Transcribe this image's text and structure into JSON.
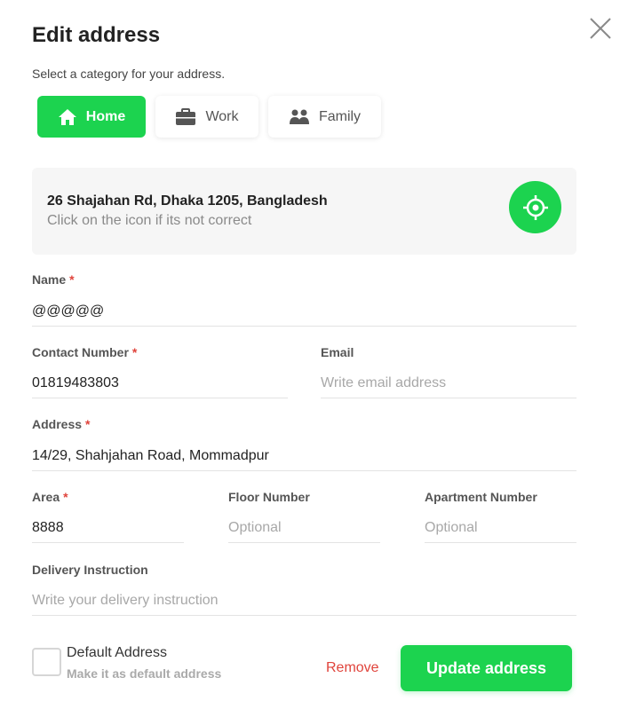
{
  "modal": {
    "title": "Edit address",
    "subtitle": "Select a category for your address."
  },
  "categories": [
    {
      "label": "Home",
      "icon": "home-icon",
      "selected": true
    },
    {
      "label": "Work",
      "icon": "briefcase-icon",
      "selected": false
    },
    {
      "label": "Family",
      "icon": "users-icon",
      "selected": false
    }
  ],
  "location": {
    "address": "26 Shajahan Rd, Dhaka 1205, Bangladesh",
    "hint": "Click on the icon if its not correct",
    "icon": "crosshair-icon"
  },
  "form": {
    "name": {
      "label": "Name",
      "required_mark": "*",
      "value": "@@@@@",
      "placeholder": ""
    },
    "contact": {
      "label": "Contact Number",
      "required_mark": "*",
      "value": "01819483803",
      "placeholder": ""
    },
    "email": {
      "label": "Email",
      "value": "",
      "placeholder": "Write email address"
    },
    "address": {
      "label": "Address",
      "required_mark": "*",
      "value": "14/29, Shahjahan Road, Mommadpur",
      "placeholder": ""
    },
    "area": {
      "label": "Area",
      "required_mark": "*",
      "value": "8888",
      "placeholder": ""
    },
    "floor": {
      "label": "Floor Number",
      "value": "",
      "placeholder": "Optional"
    },
    "apartment": {
      "label": "Apartment Number",
      "value": "",
      "placeholder": "Optional"
    },
    "instruction": {
      "label": "Delivery Instruction",
      "value": "",
      "placeholder": "Write your delivery instruction"
    }
  },
  "default_address": {
    "label": "Default Address",
    "sublabel": "Make it as default address",
    "checked": false
  },
  "actions": {
    "remove_label": "Remove",
    "update_label": "Update address"
  },
  "colors": {
    "accent": "#1cd34f",
    "danger": "#e0443c"
  }
}
